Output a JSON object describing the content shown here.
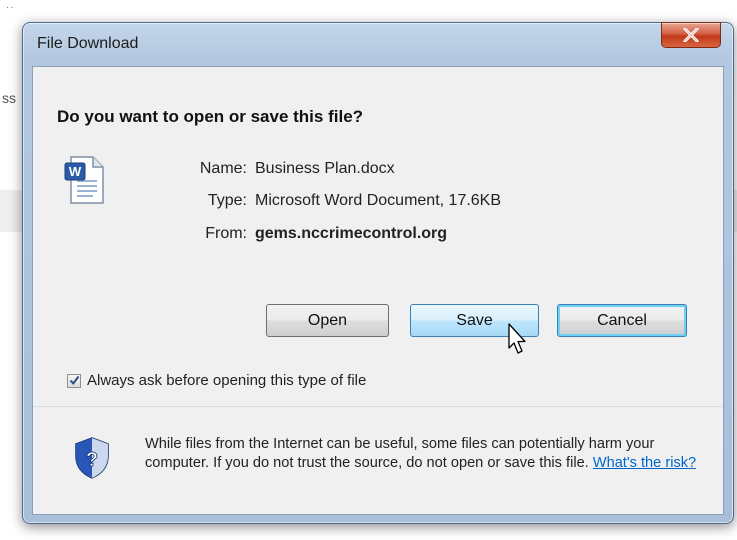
{
  "dialog": {
    "title": "File Download",
    "heading": "Do you want to open or save this file?",
    "file": {
      "name_label": "Name:",
      "name_value": "Business Plan.docx",
      "type_label": "Type:",
      "type_value": "Microsoft Word Document, 17.6KB",
      "from_label": "From:",
      "from_value": "gems.nccrimecontrol.org"
    },
    "buttons": {
      "open": "Open",
      "save": "Save",
      "cancel": "Cancel"
    },
    "checkbox": {
      "label": "Always ask before opening this type of file",
      "checked": true
    },
    "warning": {
      "text": "While files from the Internet can be useful, some files can potentially harm your computer. If you do not trust the source, do not open or save this file. ",
      "link": "What's the risk?"
    }
  },
  "background": {
    "fragment": "ss",
    "dots": "··"
  },
  "icons": [
    "close-icon",
    "word-document-icon",
    "mouse-pointer-icon",
    "checkmark-icon",
    "security-shield-icon"
  ],
  "colors": {
    "frame": "#b3c8e0",
    "close_button": "#c2391c",
    "link": "#0066cc",
    "client_bg": "#f0f0f0"
  }
}
